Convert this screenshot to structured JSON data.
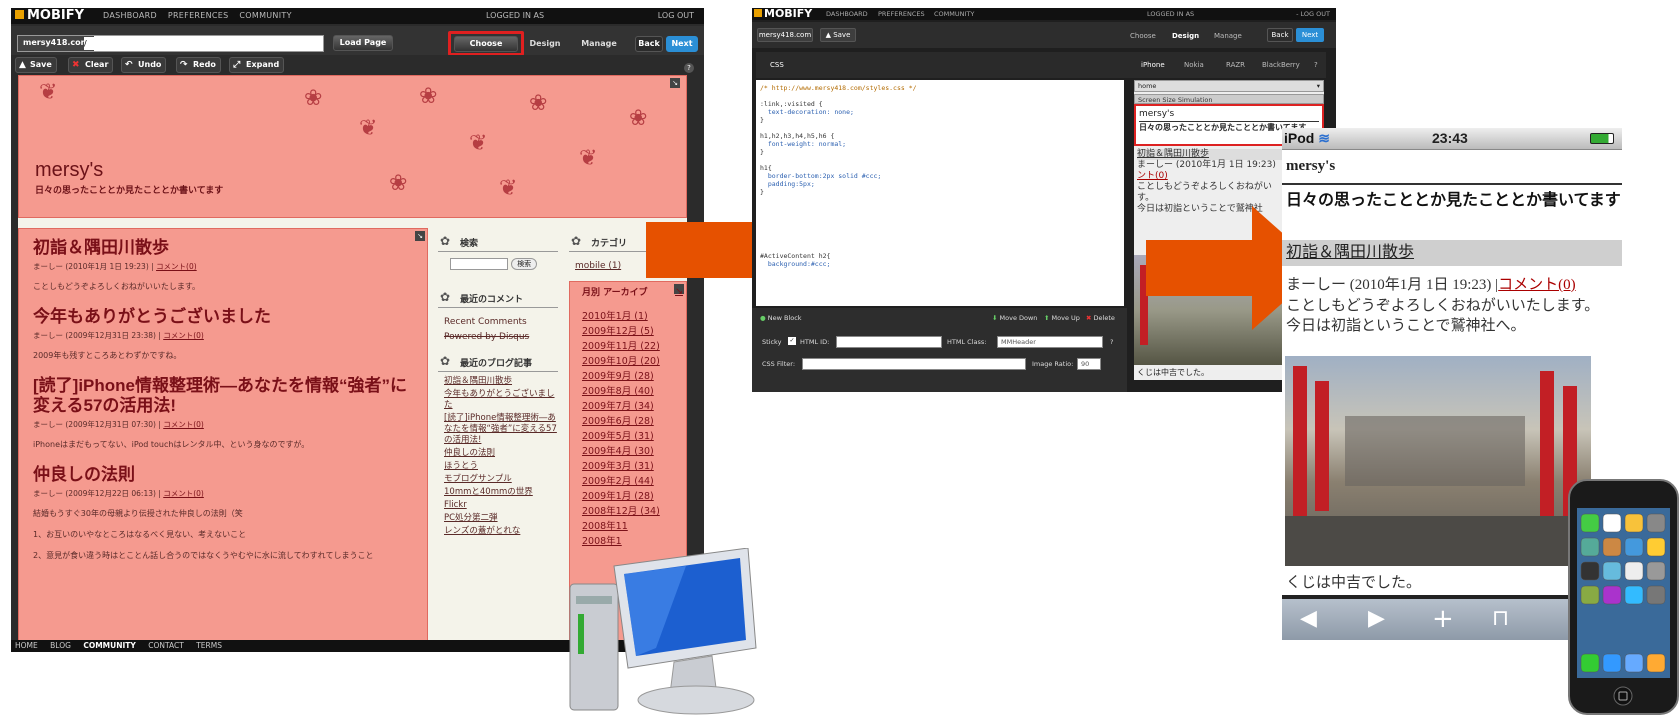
{
  "panel1": {
    "logo": "MOBIFY",
    "menu": [
      "DASHBOARD",
      "PREFERENCES",
      "COMMUNITY"
    ],
    "logged_in": "LOGGED IN AS",
    "logout": "LOG OUT",
    "domain": "mersy418.com",
    "url_value": "/",
    "load_page": "Load Page",
    "choose": "Choose",
    "design": "Design",
    "manage": "Manage",
    "back": "Back",
    "next": "Next",
    "actions": {
      "save": "Save",
      "clear": "Clear",
      "undo": "Undo",
      "redo": "Redo",
      "expand": "Expand"
    },
    "help": "?",
    "blog": {
      "title": "mersy's",
      "subtitle": "日々の思ったこととか見たこととか書いてます",
      "posts": [
        {
          "title": "初詣＆隅田川散歩",
          "meta": "まーしー (2010年1月 1日 19:23) |",
          "comment": "コメント(0)",
          "text": "ことしもどうぞよろしくおねがいいたします。"
        },
        {
          "title": "今年もありがとうございました",
          "meta": "まーしー (2009年12月31日 23:38) |",
          "comment": "コメント(0)",
          "text": "2009年も残すところあとわずかですね。"
        },
        {
          "title": "[読了]iPhone情報整理術―あなたを情報“強者”に変える57の活用法!",
          "meta": "まーしー (2009年12月31日 07:30) |",
          "comment": "コメント(0)",
          "text": "iPhoneはまだもってない、iPod touchはレンタル中、という身なのですが。"
        },
        {
          "title": "仲良しの法則",
          "meta": "まーしー (2009年12月22日 06:13) |",
          "comment": "コメント(0)",
          "text": "結婚もうすぐ30年の母親より伝授された仲良しの法則（笑"
        }
      ],
      "post4_list": [
        "1、お互いのいやなところはなるべく見ない、考えないこと",
        "2、意見が食い違う時はとことん話し合うのではなくうやむやに水に流してわすれてしまうこと"
      ],
      "search_title": "検索",
      "search_button": "検索",
      "category_title": "カテゴリ",
      "category_item": "mobile (1)",
      "recent_comments_title": "最近のコメント",
      "recent_comments": "Recent Comments",
      "powered": "Powered by Disqus",
      "recent_posts_title": "最近のブログ記事",
      "recent_posts": [
        "初詣＆隅田川散歩",
        "今年もありがとうございました",
        "[読了]iPhone情報整理術―あなたを情報“強者”に変える57の活用法!",
        "仲良しの法則",
        "ほうとう",
        "モブログサンプル",
        "10mmと40mmの世界",
        "Flickr",
        "PC処分第二弾",
        "レンズの蓋がとれな"
      ],
      "archive_title": "月別 アーカイブ",
      "archives": [
        "2010年1月 (1)",
        "2009年12月 (5)",
        "2009年11月 (22)",
        "2009年10月 (20)",
        "2009年9月 (28)",
        "2009年8月 (40)",
        "2009年7月 (34)",
        "2009年6月 (28)",
        "2009年5月 (31)",
        "2009年4月 (30)",
        "2009年3月 (31)",
        "2009年2月 (44)",
        "2009年1月 (28)",
        "2008年12月 (34)",
        "2008年11",
        "2008年1"
      ]
    },
    "footer": [
      "HOME",
      "BLOG",
      "COMMUNITY",
      "CONTACT",
      "TERMS"
    ]
  },
  "panel2": {
    "logo": "MOBIFY",
    "menu": [
      "DASHBOARD",
      "PREFERENCES",
      "COMMUNITY"
    ],
    "logged_in": "LOGGED IN AS",
    "logout": "- LOG OUT",
    "domain": "mersy418.com",
    "save": "Save",
    "choose": "Choose",
    "design": "Design",
    "manage": "Manage",
    "back": "Back",
    "next": "Next",
    "css_tab": "CSS",
    "devices": [
      "iPhone",
      "Nokia",
      "RAZR",
      "BlackBerry"
    ],
    "help": "?",
    "select_value": "home",
    "sim_header": "Screen Size Simulation",
    "sim_title": "mersy's",
    "sim_desc": "日々の思ったこととか見たこととか書いてます",
    "sim_lines": [
      "初詣＆隅田川散歩",
      "まーしー (2010年1月 1日 19:23)",
      "ント(0)",
      "ことしもどうぞよろしくおねがい",
      "す。",
      "今日は初詣ということで鷲神社"
    ],
    "sim_caption": "くじは中吉でした。",
    "css_code": [
      "/* http://www.mersy418.com/styles.css */",
      "",
      ":link,:visited {",
      "  text-decoration: none;",
      "}",
      "",
      "h1,h2,h3,h4,h5,h6 {",
      "  font-weight: normal;",
      "}",
      "",
      "h1{",
      "  border-bottom:2px solid #ccc;",
      "  padding:5px;",
      "}",
      "",
      "",
      "",
      "",
      "",
      "",
      "",
      "#ActiveContent h2{",
      "  background:#ccc;"
    ],
    "new_block": "New Block",
    "move_down": "Move Down",
    "move_up": "Move Up",
    "delete": "Delete",
    "sticky": "Sticky",
    "html_id": "HTML ID:",
    "html_class": "HTML Class:",
    "html_class_value": "MMHeader",
    "css_filter": "CSS Filter:",
    "image_ratio": "Image Ratio:",
    "image_ratio_value": "90"
  },
  "panel3": {
    "carrier": "iPod",
    "time": "23:43",
    "title": "mersy's",
    "desc": "日々の思ったこととか見たこととか書いてます",
    "post_title": "初詣＆隅田川散歩",
    "meta": "まーしー (2010年1月 1日 19:23) |",
    "comment": "コメント(0)",
    "text1": "ことしもどうぞよろしくおねがいいたします。",
    "text2": "今日は初詣ということで鷲神社へ。",
    "caption": "くじは中吉でした。"
  },
  "colors": {
    "accent_red": "#e02020",
    "arrow_orange": "#e65100",
    "blog_pink": "#f59a8f",
    "next_blue": "#2b8fd6"
  }
}
